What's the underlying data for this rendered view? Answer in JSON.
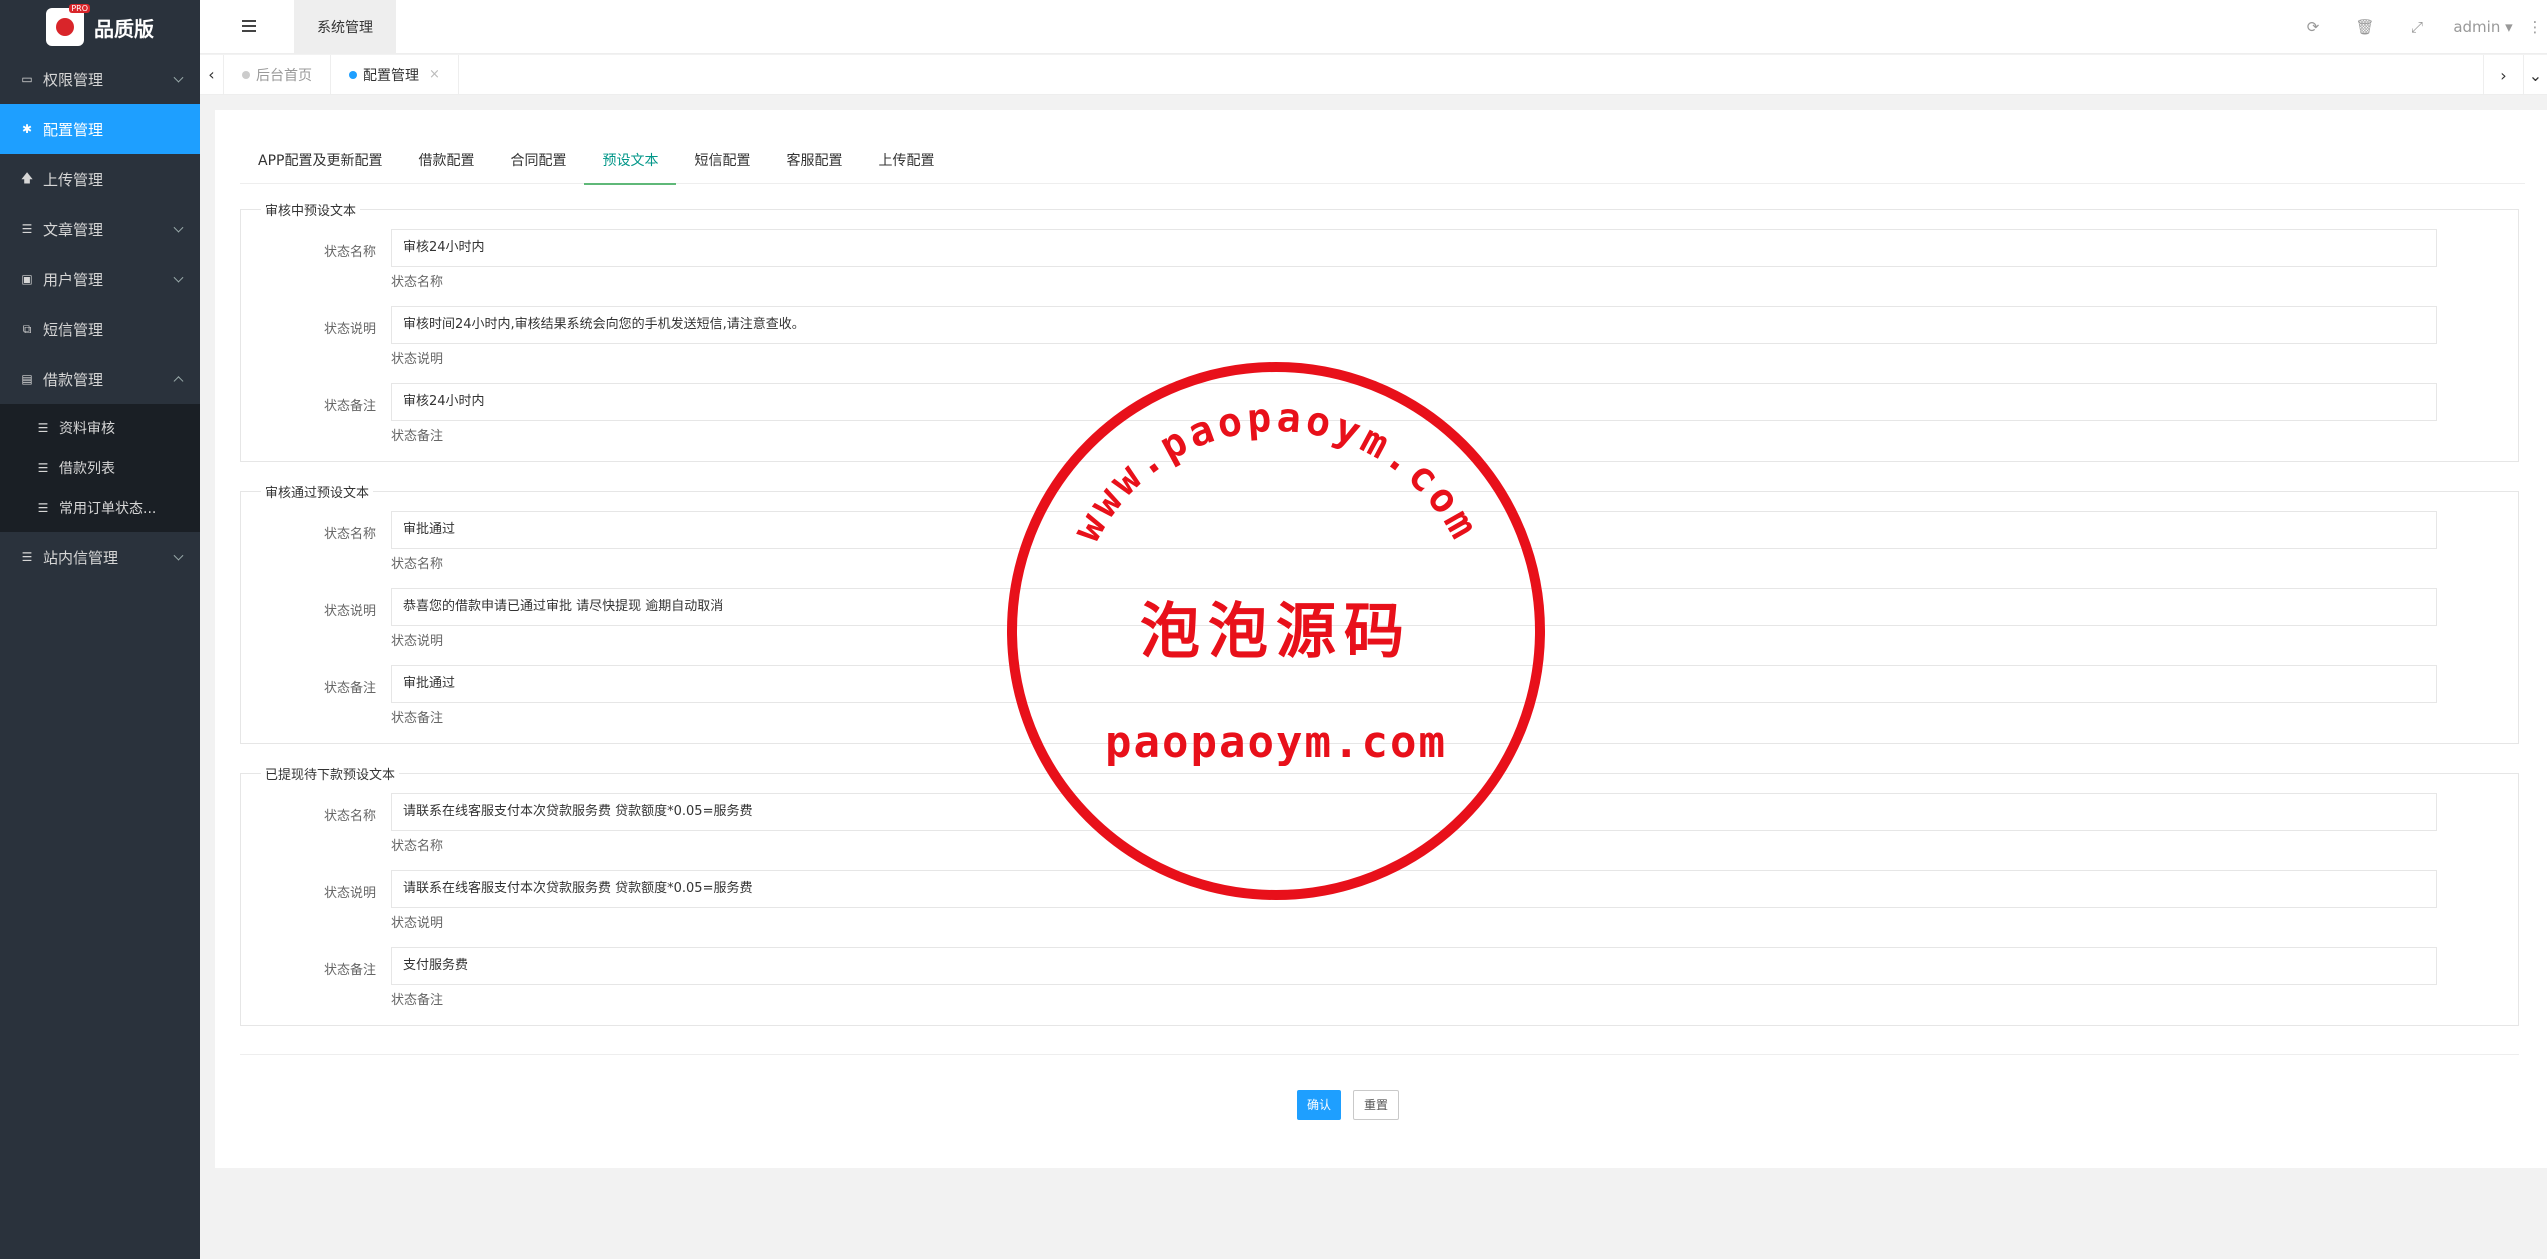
{
  "sidebar": {
    "brand": "品质版",
    "items": [
      {
        "icon": "laptop-icon",
        "label": "权限管理"
      },
      {
        "icon": "gear-icon",
        "label": "配置管理"
      },
      {
        "icon": "upload-icon",
        "label": "上传管理"
      },
      {
        "icon": "list-icon",
        "label": "文章管理"
      },
      {
        "icon": "user-icon",
        "label": "用户管理"
      },
      {
        "icon": "copy-icon",
        "label": "短信管理"
      },
      {
        "icon": "money-icon",
        "label": "借款管理"
      },
      {
        "icon": "list-icon",
        "label": "站内信管理"
      }
    ],
    "subitems": [
      {
        "label": "资料审核"
      },
      {
        "label": "借款列表"
      },
      {
        "label": "常用订单状态..."
      }
    ]
  },
  "header": {
    "system_tab": "系统管理",
    "user": "admin"
  },
  "pagetabs": {
    "home": "后台首页",
    "current": "配置管理",
    "close": "×"
  },
  "config_tabs": [
    "APP配置及更新配置",
    "借款配置",
    "合同配置",
    "预设文本",
    "短信配置",
    "客服配置",
    "上传配置"
  ],
  "sections": [
    {
      "legend": "审核中预设文本",
      "fields": [
        {
          "label": "状态名称",
          "value": "审核24小时内",
          "tip": "状态名称"
        },
        {
          "label": "状态说明",
          "value": "审核时间24小时内,审核结果系统会向您的手机发送短信,请注意查收。",
          "tip": "状态说明"
        },
        {
          "label": "状态备注",
          "value": "审核24小时内",
          "tip": "状态备注"
        }
      ]
    },
    {
      "legend": "审核通过预设文本",
      "fields": [
        {
          "label": "状态名称",
          "value": "审批通过",
          "tip": "状态名称"
        },
        {
          "label": "状态说明",
          "value": "恭喜您的借款申请已通过审批 请尽快提现 逾期自动取消",
          "tip": "状态说明"
        },
        {
          "label": "状态备注",
          "value": "审批通过",
          "tip": "状态备注"
        }
      ]
    },
    {
      "legend": "已提现待下款预设文本",
      "fields": [
        {
          "label": "状态名称",
          "value": "请联系在线客服支付本次贷款服务费 贷款额度*0.05=服务费",
          "tip": "状态名称"
        },
        {
          "label": "状态说明",
          "value": "请联系在线客服支付本次贷款服务费 贷款额度*0.05=服务费",
          "tip": "状态说明"
        },
        {
          "label": "状态备注",
          "value": "支付服务费",
          "tip": "状态备注"
        }
      ]
    }
  ],
  "buttons": {
    "confirm": "确认",
    "reset": "重置"
  },
  "watermark": {
    "ring_text": "www.paopaoym.com",
    "center": "泡泡源码",
    "bottom": "paopaoym.com"
  },
  "colors": {
    "accent": "#1e9fff",
    "sidebar": "#2a323c",
    "tab_active": "#009688",
    "stamp": "#e8101a"
  }
}
